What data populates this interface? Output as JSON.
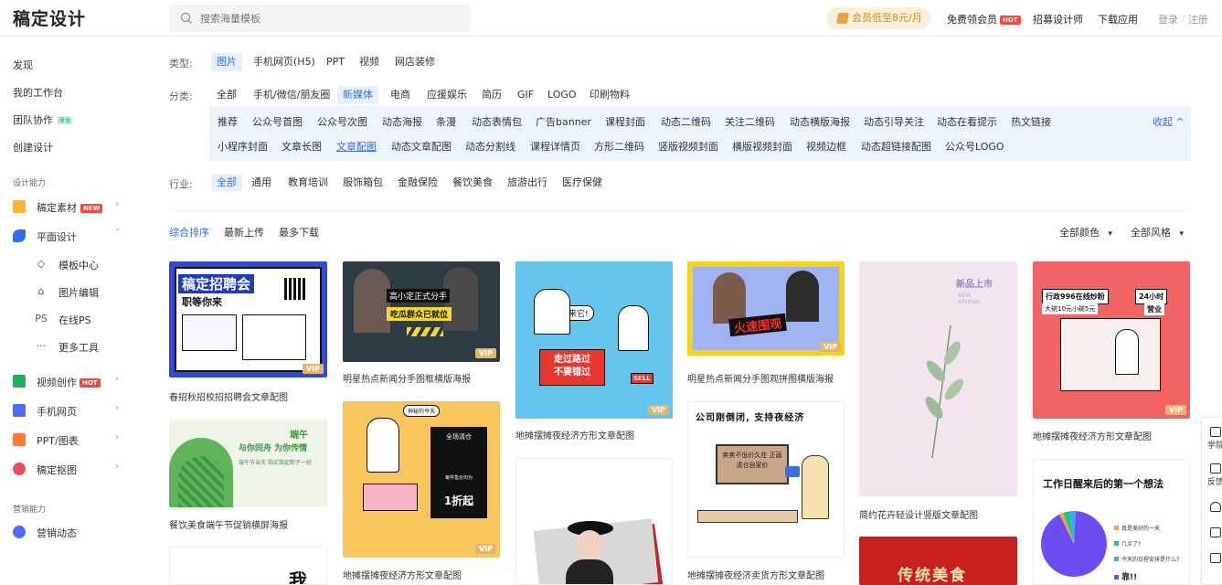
{
  "header": {
    "logo": "稿定设计",
    "search_placeholder": "搜索海量模板",
    "vip_badge": "会员低至8元/月",
    "free_vip": "免费领会员",
    "hot": "HOT",
    "recruit": "招募设计师",
    "download": "下载应用",
    "login": "登录",
    "slash": "/",
    "register": "注册"
  },
  "sidebar": {
    "top_items": [
      "发现",
      "我的工作台",
      "团队协作",
      "创建设计"
    ],
    "team_badge": "限免",
    "group_design": "设计能力",
    "material": "稿定素材",
    "new": "NEW",
    "graphic": "平面设计",
    "graphic_subs": [
      {
        "icon": "◇",
        "label": "模板中心"
      },
      {
        "icon": "⌂",
        "label": "图片编辑"
      },
      {
        "icon": "PS",
        "label": "在线PS"
      },
      {
        "icon": "···",
        "label": "更多工具"
      }
    ],
    "video": "视频创作",
    "hot": "HOT",
    "h5": "手机网页",
    "ppt": "PPT/图表",
    "cutout": "稿定抠图",
    "group_marketing": "营销能力",
    "marketing": "营销动态"
  },
  "filters": {
    "type_label": "类型:",
    "types": [
      "图片",
      "手机网页(H5)",
      "PPT",
      "视频",
      "网店装修"
    ],
    "cat_label": "分类:",
    "cats": [
      "全部",
      "手机/微信/朋友圈",
      "新媒体",
      "电商",
      "应援娱乐",
      "简历",
      "GIF",
      "LOGO",
      "印刷物料"
    ],
    "sub_row1": [
      "推荐",
      "公众号首图",
      "公众号次图",
      "动态海报",
      "条漫",
      "动态表情包",
      "广告banner",
      "课程封面",
      "动态二维码",
      "关注二维码",
      "动态横版海报",
      "动态引导关注",
      "动态在看提示",
      "热文链接"
    ],
    "sub_row2": [
      "小程序封面",
      "文章长图",
      "文章配图",
      "动态文章配图",
      "动态分割线",
      "课程详情页",
      "方形二维码",
      "竖版视频封面",
      "横版视频封面",
      "视频边框",
      "动态超链接配图",
      "公众号LOGO"
    ],
    "collapse": "收起 ^",
    "ind_label": "行业:",
    "inds": [
      "全部",
      "通用",
      "教育培训",
      "服饰箱包",
      "金融保险",
      "餐饮美食",
      "旅游出行",
      "医疗保健"
    ]
  },
  "sort": {
    "items": [
      "综合排序",
      "最新上传",
      "最多下载"
    ],
    "color": "全部颜色",
    "style": "全部风格",
    "arrow": "▾"
  },
  "cards": {
    "vip": "VIP",
    "c1": {
      "title": "稿定招聘会",
      "sub": "职等你来",
      "caption": "春招秋招校招招聘会文章配图"
    },
    "c2": {
      "bubble": "高小定正式分手",
      "label": "吃瓜群众已就位",
      "caption": "明星热点新闻分手图框横版海报"
    },
    "c3": {
      "shout": "来它!",
      "l1": "走过路过",
      "l2": "不要错过",
      "sell": "SELL",
      "caption": "地摊摆摊夜经济方形文章配图"
    },
    "c4": {
      "title": "火速围观",
      "caption": "明星热点新闻分手图观拼图横版海报"
    },
    "c5": {
      "title": "新品上市",
      "en": "NEW ARRIVAL",
      "caption": "简约花卉轻设计竖版文章配图"
    },
    "c6": {
      "t1": "行政996在线炒粉",
      "t2": "24小时",
      "t3": "营业",
      "t4": "大碗10元小碗5元",
      "caption": "地摊摆摊夜经济方形文章配图"
    },
    "c7": {
      "title": "端午",
      "sub": "与你同舟 为你传情",
      "line": "端午节当天 购买指定粽子一份",
      "caption": "餐饮美食端午节促销横屏海报"
    },
    "c8": {
      "top": "神秘的今天",
      "t1": "全场清仓",
      "t2": "每件售价均为",
      "t3": "1折起",
      "caption": "地摊摆摊夜经济方形文章配图"
    },
    "c9": {
      "title": "公司刚倒闭, 支持夜经济",
      "board": "卖卖不低价久在 正画清仓自家价",
      "caption": "地摊摆摊夜经济卖货方形文章配图"
    },
    "c10": {
      "title": "工作日醒来后的第一个想法",
      "legend": [
        "真是美好的一天",
        "几点了?",
        "今天的日程安排是什么?",
        "靠!!"
      ],
      "pie_values": [
        92,
        2,
        3,
        3
      ]
    },
    "c11": {
      "text": "我"
    },
    "c13": {
      "title": "传统美食"
    }
  },
  "right_tools": [
    "学院",
    "反馈"
  ]
}
